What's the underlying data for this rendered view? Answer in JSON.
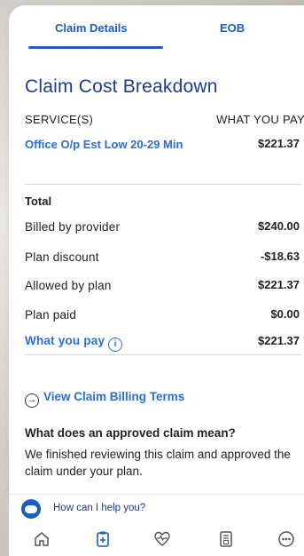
{
  "tabs": [
    {
      "label": "Claim Details",
      "active": true
    },
    {
      "label": "EOB",
      "active": false
    }
  ],
  "title": "Claim Cost Breakdown",
  "columns": {
    "service": "SERVICE(S)",
    "pay": "WHAT YOU PAY"
  },
  "service": {
    "name": "Office O/p Est Low 20-29 Min",
    "amount": "$221.37"
  },
  "total": {
    "heading": "Total",
    "rows": [
      {
        "label": "Billed by provider",
        "value": "$240.00"
      },
      {
        "label": "Plan discount",
        "value": "-$18.63"
      },
      {
        "label": "Allowed by plan",
        "value": "$221.37"
      },
      {
        "label": "Plan paid",
        "value": "$0.00"
      }
    ],
    "you_pay": {
      "label": "What you pay",
      "value": "$221.37",
      "info_glyph": "i"
    }
  },
  "billing_terms": {
    "label": "View Claim Billing Terms",
    "icon": "arrow-circle-right-icon"
  },
  "faq": {
    "question": "What does an approved claim mean?",
    "answer": "We finished reviewing this claim and approved the claim under your plan."
  },
  "help": {
    "text": "How can I help you?"
  },
  "nav": [
    {
      "icon": "home-icon"
    },
    {
      "icon": "clipboard-icon",
      "active": true
    },
    {
      "icon": "heart-pulse-icon"
    },
    {
      "icon": "receipt-icon"
    },
    {
      "icon": "more-icon"
    }
  ],
  "colors": {
    "accent": "#1a5fbf",
    "link": "#2a6fd6",
    "title": "#1b3d8f"
  }
}
